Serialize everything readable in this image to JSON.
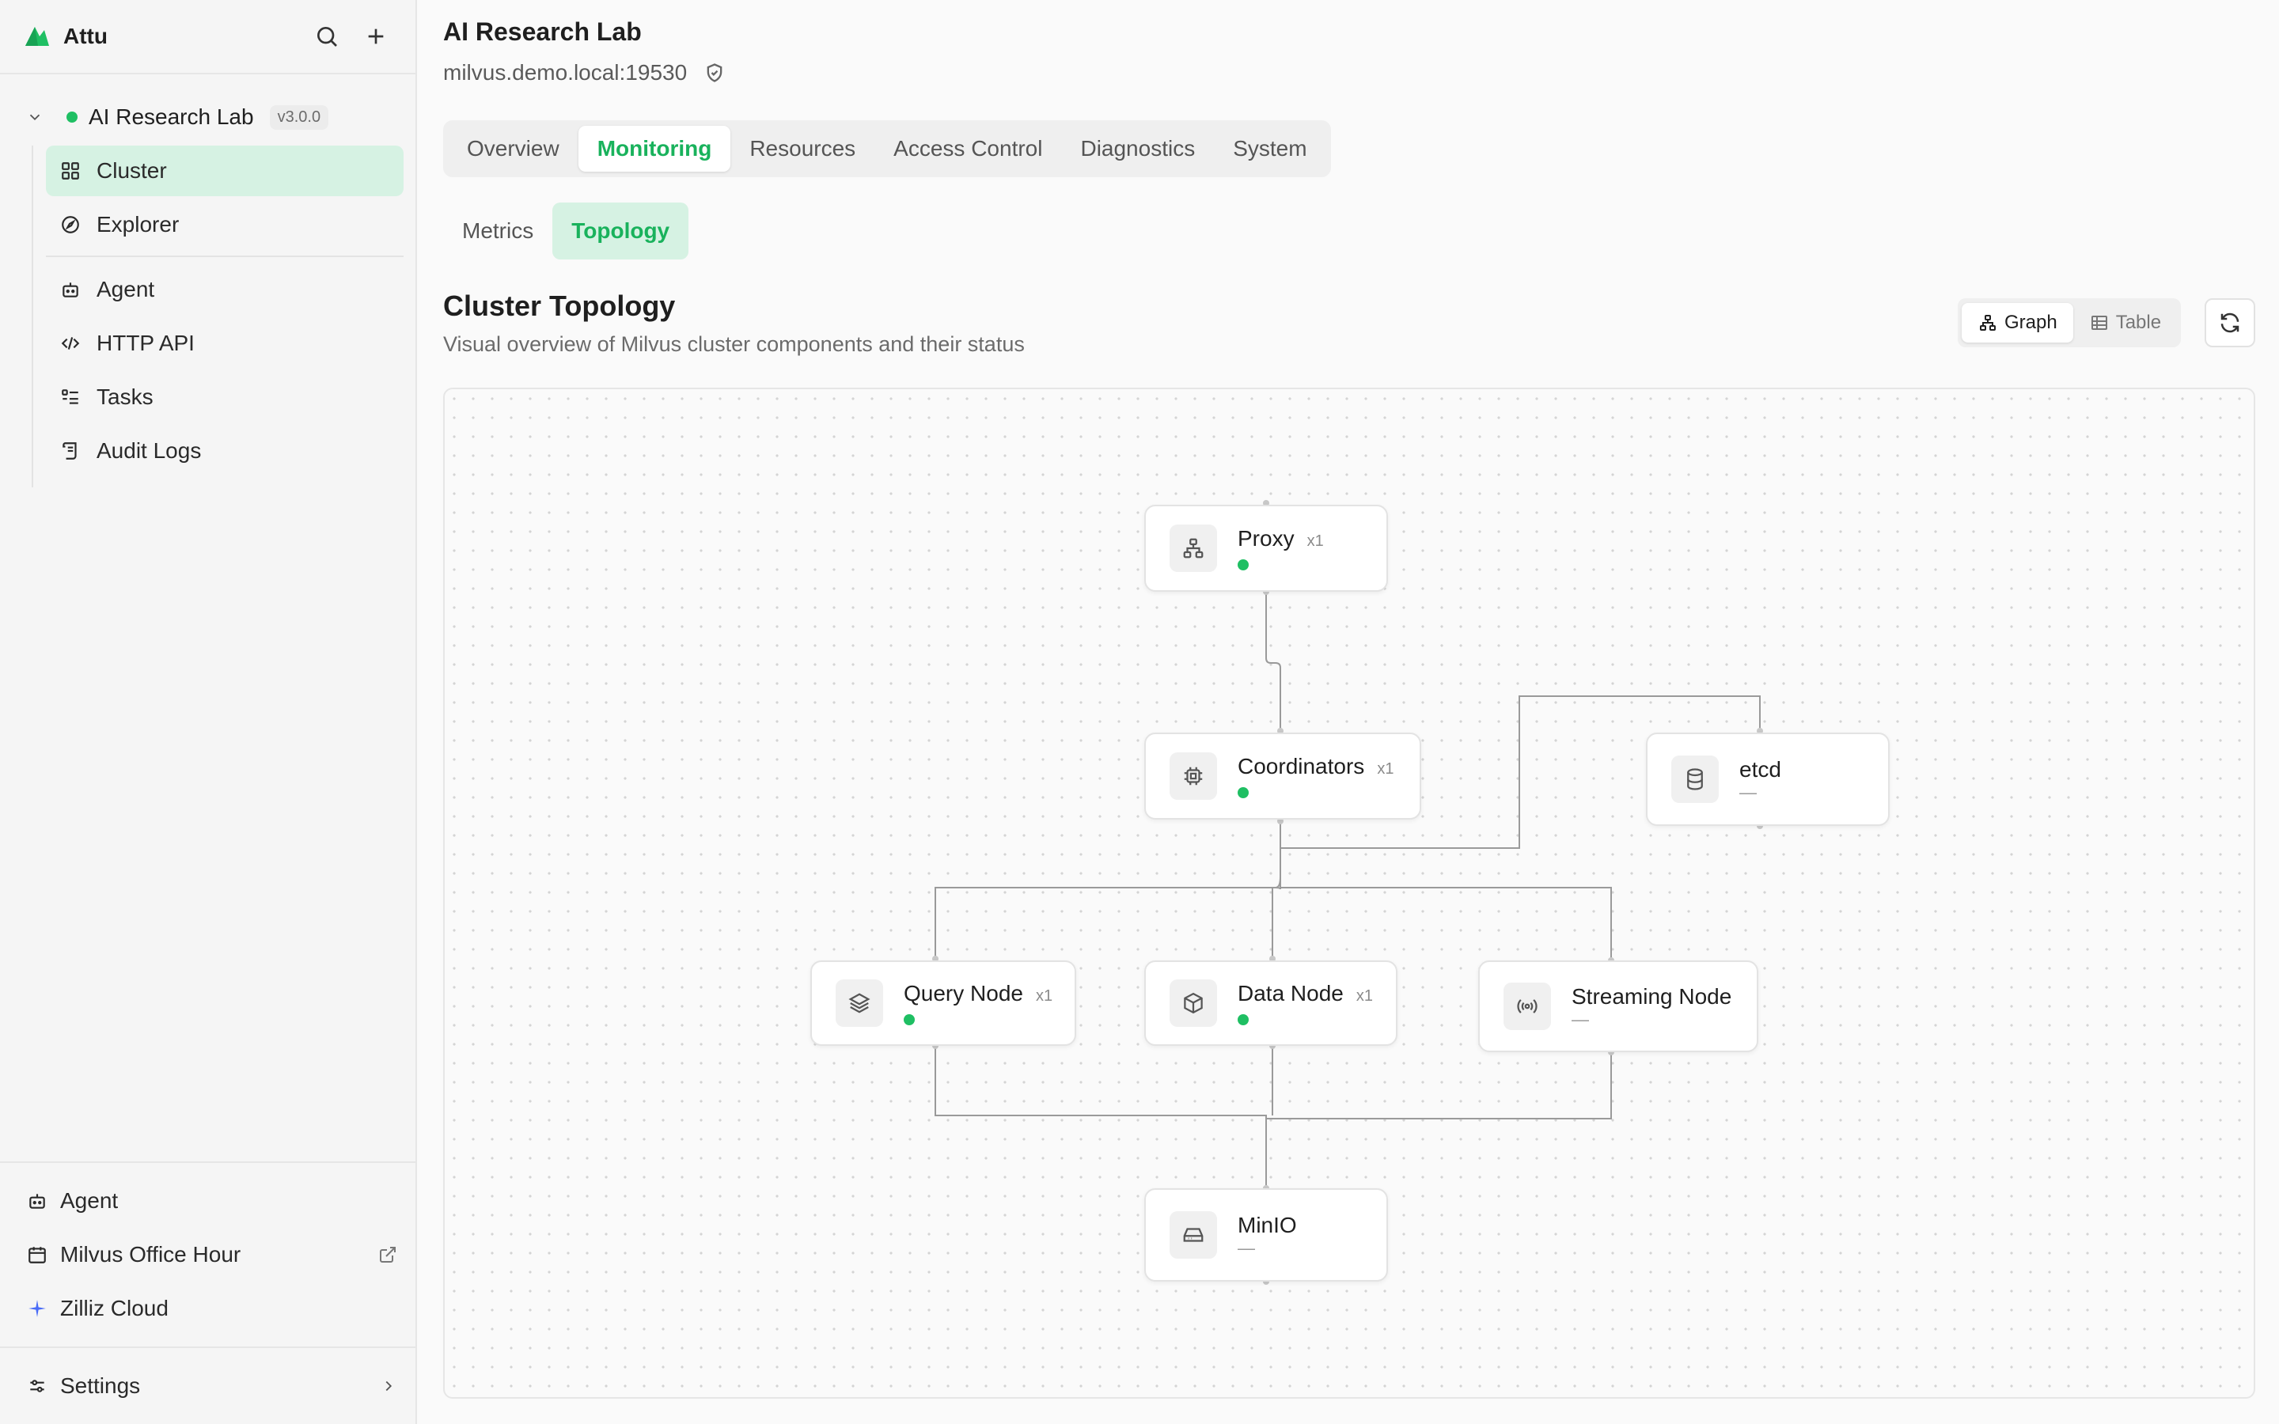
{
  "app": {
    "name": "Attu"
  },
  "sidebar": {
    "cluster": {
      "name": "AI Research Lab",
      "version": "v3.0.0"
    },
    "items": [
      {
        "label": "Cluster",
        "icon": "grid-icon"
      },
      {
        "label": "Explorer",
        "icon": "compass-icon"
      },
      {
        "label": "Agent",
        "icon": "bot-icon"
      },
      {
        "label": "HTTP API",
        "icon": "code-icon"
      },
      {
        "label": "Tasks",
        "icon": "list-check-icon"
      },
      {
        "label": "Audit Logs",
        "icon": "scroll-icon"
      }
    ],
    "bottom": [
      {
        "label": "Agent",
        "icon": "bot-icon"
      },
      {
        "label": "Milvus Office Hour",
        "icon": "calendar-icon"
      },
      {
        "label": "Zilliz Cloud",
        "icon": "sparkle-icon"
      }
    ],
    "settings_label": "Settings"
  },
  "header": {
    "title": "AI Research Lab",
    "host": "milvus.demo.local:19530"
  },
  "tabs": [
    "Overview",
    "Monitoring",
    "Resources",
    "Access Control",
    "Diagnostics",
    "System"
  ],
  "active_tab": "Monitoring",
  "subtabs": [
    "Metrics",
    "Topology"
  ],
  "active_subtab": "Topology",
  "section": {
    "title": "Cluster Topology",
    "subtitle": "Visual overview of Milvus cluster components and their status"
  },
  "view_toggle": {
    "graph": "Graph",
    "table": "Table",
    "active": "Graph"
  },
  "topology": {
    "nodes": {
      "proxy": {
        "name": "Proxy",
        "count": "x1",
        "status": "healthy"
      },
      "coordinators": {
        "name": "Coordinators",
        "count": "x1",
        "status": "healthy"
      },
      "etcd": {
        "name": "etcd",
        "count": "",
        "status": "—"
      },
      "query_node": {
        "name": "Query Node",
        "count": "x1",
        "status": "healthy"
      },
      "data_node": {
        "name": "Data Node",
        "count": "x1",
        "status": "healthy"
      },
      "streaming_node": {
        "name": "Streaming Node",
        "count": "",
        "status": "—"
      },
      "minio": {
        "name": "MinIO",
        "count": "",
        "status": "—"
      }
    },
    "status_color": "#1fbf63"
  },
  "colors": {
    "accent": "#19b25c",
    "active_bg": "#d6f2e3"
  }
}
